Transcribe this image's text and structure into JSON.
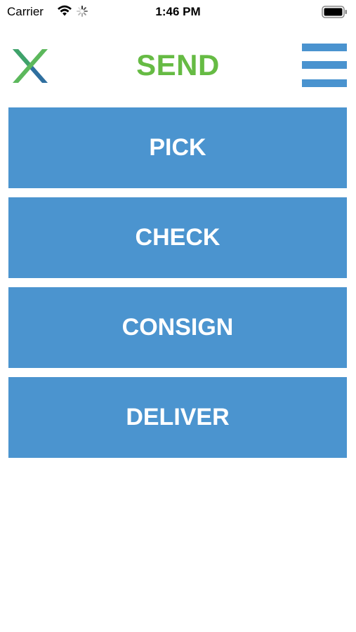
{
  "status_bar": {
    "carrier": "Carrier",
    "time": "1:46 PM",
    "icons": [
      "wifi-icon",
      "activity-spinner-icon",
      "battery-icon"
    ]
  },
  "header": {
    "title": "SEND",
    "title_color": "#66bb44",
    "logo_icon": "x-logo-icon",
    "menu_icon": "hamburger-menu-icon"
  },
  "actions": [
    {
      "label": "PICK"
    },
    {
      "label": "CHECK"
    },
    {
      "label": "CONSIGN"
    },
    {
      "label": "DELIVER"
    }
  ],
  "colors": {
    "button_background": "#4b94cf",
    "button_text": "#ffffff",
    "menu_bars": "#4a93cf",
    "logo_green": "#5cb85c",
    "logo_blue": "#2f6f9f"
  }
}
